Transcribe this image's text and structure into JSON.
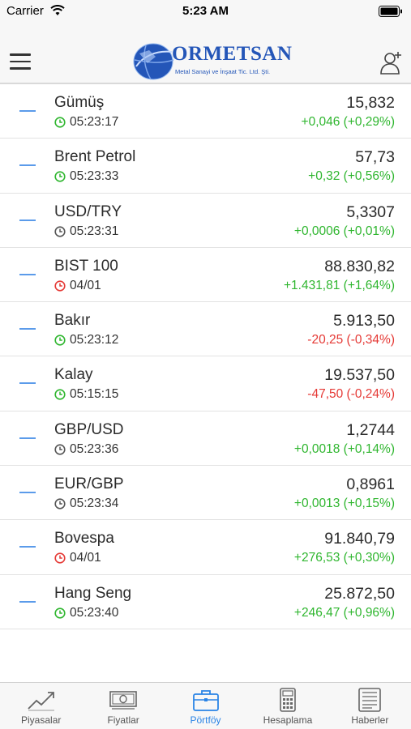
{
  "status_bar": {
    "carrier": "Carrier",
    "time": "5:23 AM"
  },
  "header": {
    "logo_title": "ORMETSAN",
    "logo_subtitle": "Metal Sanayi ve İnşaat Tic. Ltd. Şti.",
    "menu_icon": "hamburger-icon",
    "user_icon": "user-add-icon"
  },
  "colors": {
    "up": "#2fb62f",
    "down": "#e53935",
    "accent": "#2a84e6",
    "dash": "#5b9bea"
  },
  "rows": [
    {
      "name": "Gümüş",
      "time": "05:23:17",
      "clock": "green",
      "value": "15,832",
      "change": "+0,046 (+0,29%)",
      "dir": "up"
    },
    {
      "name": "Brent Petrol",
      "time": "05:23:33",
      "clock": "green",
      "value": "57,73",
      "change": "+0,32 (+0,56%)",
      "dir": "up"
    },
    {
      "name": "USD/TRY",
      "time": "05:23:31",
      "clock": "gray",
      "value": "5,3307",
      "change": "+0,0006 (+0,01%)",
      "dir": "up"
    },
    {
      "name": "BIST 100",
      "time": "04/01",
      "clock": "red",
      "value": "88.830,82",
      "change": "+1.431,81 (+1,64%)",
      "dir": "up"
    },
    {
      "name": "Bakır",
      "time": "05:23:12",
      "clock": "green",
      "value": "5.913,50",
      "change": "-20,25 (-0,34%)",
      "dir": "down"
    },
    {
      "name": "Kalay",
      "time": "05:15:15",
      "clock": "green",
      "value": "19.537,50",
      "change": "-47,50 (-0,24%)",
      "dir": "down"
    },
    {
      "name": "GBP/USD",
      "time": "05:23:36",
      "clock": "gray",
      "value": "1,2744",
      "change": "+0,0018 (+0,14%)",
      "dir": "up"
    },
    {
      "name": "EUR/GBP",
      "time": "05:23:34",
      "clock": "gray",
      "value": "0,8961",
      "change": "+0,0013 (+0,15%)",
      "dir": "up"
    },
    {
      "name": "Bovespa",
      "time": "04/01",
      "clock": "red",
      "value": "91.840,79",
      "change": "+276,53 (+0,30%)",
      "dir": "up"
    },
    {
      "name": "Hang Seng",
      "time": "05:23:40",
      "clock": "green",
      "value": "25.872,50",
      "change": "+246,47 (+0,96%)",
      "dir": "up"
    }
  ],
  "tabs": [
    {
      "label": "Piyasalar",
      "icon": "trend-chart-icon",
      "active": false
    },
    {
      "label": "Fiyatlar",
      "icon": "banknote-icon",
      "active": false
    },
    {
      "label": "Pörtföy",
      "icon": "briefcase-icon",
      "active": true
    },
    {
      "label": "Hesaplama",
      "icon": "calculator-icon",
      "active": false
    },
    {
      "label": "Haberler",
      "icon": "newspaper-icon",
      "active": false
    }
  ]
}
